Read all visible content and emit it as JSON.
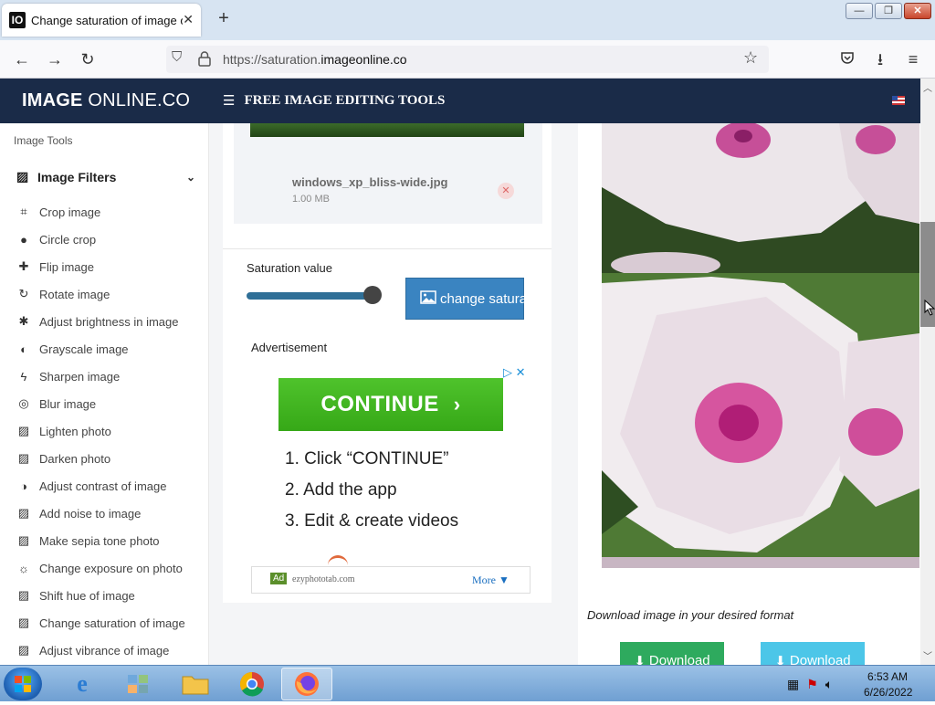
{
  "browser": {
    "tab_title": "Change saturation of image onl",
    "tab_favicon": "IO",
    "new_tab": "+",
    "url_prefix": "https://saturation.",
    "url_domain": "imageonline.co",
    "window_min": "—",
    "window_max": "❐",
    "window_close": "✕"
  },
  "site": {
    "logo_bold": "IMAGE",
    "logo_rest": " ONLINE.CO",
    "tools_menu": "FREE IMAGE EDITING TOOLS"
  },
  "sidebar": {
    "caption": "Image Tools",
    "section": "Image Filters",
    "items": [
      {
        "label": "Crop image",
        "icon": "crop-icon",
        "glyph": "⌗"
      },
      {
        "label": "Circle crop",
        "icon": "circle-check-icon",
        "glyph": "●"
      },
      {
        "label": "Flip image",
        "icon": "plus-icon",
        "glyph": "✚"
      },
      {
        "label": "Rotate image",
        "icon": "rotate-icon",
        "glyph": "↻"
      },
      {
        "label": "Adjust brightness in image",
        "icon": "asterisk-icon",
        "glyph": "✱"
      },
      {
        "label": "Grayscale image",
        "icon": "half-circle-icon",
        "glyph": "◐"
      },
      {
        "label": "Sharpen image",
        "icon": "bolt-icon",
        "glyph": "ϟ"
      },
      {
        "label": "Blur image",
        "icon": "eye-slash-icon",
        "glyph": "◎"
      },
      {
        "label": "Lighten photo",
        "icon": "image-icon",
        "glyph": "▨"
      },
      {
        "label": "Darken photo",
        "icon": "image-icon",
        "glyph": "▨"
      },
      {
        "label": "Adjust contrast of image",
        "icon": "half-circle-icon",
        "glyph": "◑"
      },
      {
        "label": "Add noise to image",
        "icon": "image-icon",
        "glyph": "▨"
      },
      {
        "label": "Make sepia tone photo",
        "icon": "image-icon",
        "glyph": "▨"
      },
      {
        "label": "Change exposure on photo",
        "icon": "sun-icon",
        "glyph": "☼"
      },
      {
        "label": "Shift hue of image",
        "icon": "image-icon",
        "glyph": "▨"
      },
      {
        "label": "Change saturation of image",
        "icon": "image-icon",
        "glyph": "▨"
      },
      {
        "label": "Adjust vibrance of image",
        "icon": "image-icon",
        "glyph": "▨"
      }
    ]
  },
  "upload": {
    "file_name": "windows_xp_bliss-wide.jpg",
    "file_size": "1.00 MB"
  },
  "controls": {
    "saturation_label": "Saturation value",
    "saturation_level": 1.0,
    "change_button": "change saturation"
  },
  "ad": {
    "label": "Advertisement",
    "continue": "CONTINUE",
    "steps": [
      "1. Click “CONTINUE”",
      "2. Add the app",
      "3. Edit & create videos"
    ],
    "badge": "Ad",
    "domain": "ezyphototab.com",
    "more": "More ▼"
  },
  "result": {
    "download_caption": "Download image in your desired format",
    "download_button_1": "Download",
    "download_button_2": "Download",
    "color_download_1": "#2eaa5e",
    "color_download_2": "#4cc6e8"
  },
  "taskbar": {
    "time": "6:53 AM",
    "date": "6/26/2022"
  }
}
